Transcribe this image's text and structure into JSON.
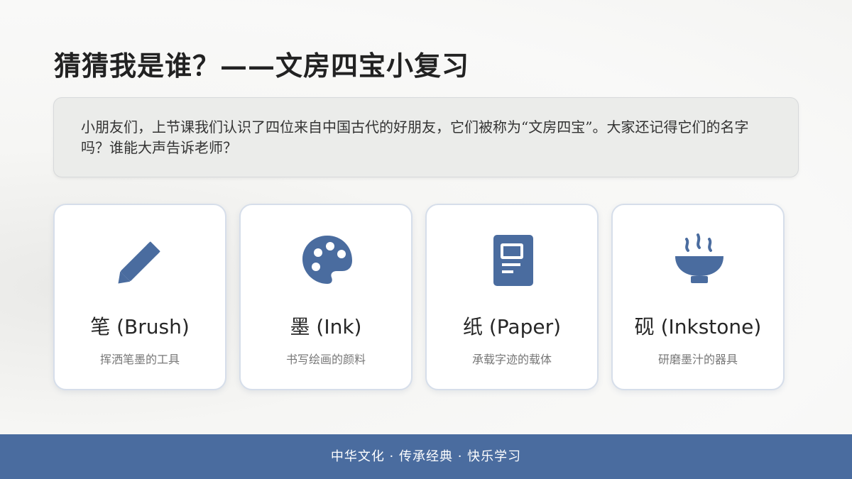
{
  "title": "猜猜我是谁？——文房四宝小复习",
  "intro": "小朋友们，上节课我们认识了四位来自中国古代的好朋友，它们被称为“文房四宝”。大家还记得它们的名字吗？谁能大声告诉老师？",
  "accent_color": "#4a6c9f",
  "cards": [
    {
      "icon": "pencil-icon",
      "name": "笔 (Brush)",
      "desc": "挥洒笔墨的工具"
    },
    {
      "icon": "palette-icon",
      "name": "墨 (Ink)",
      "desc": "书写绘画的颜料"
    },
    {
      "icon": "document-icon",
      "name": "纸 (Paper)",
      "desc": "承载字迹的载体"
    },
    {
      "icon": "steaming-bowl-icon",
      "name": "砚 (Inkstone)",
      "desc": "研磨墨汁的器具"
    }
  ],
  "footer": "中华文化 · 传承经典 · 快乐学习"
}
